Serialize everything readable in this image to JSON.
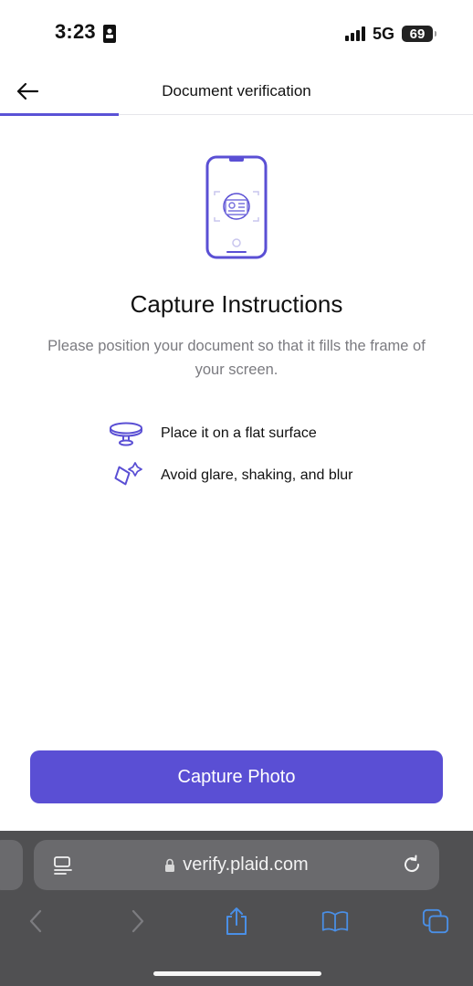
{
  "status_bar": {
    "time": "3:23",
    "network": "5G",
    "battery": "69"
  },
  "header": {
    "back_icon": "arrow-left-icon",
    "title": "Document verification",
    "progress_fraction": 0.25
  },
  "content": {
    "illustration_icon": "phone-document-scan-icon",
    "title": "Capture Instructions",
    "subtitle": "Please position your document so that it fills the frame of your screen.",
    "tips": [
      {
        "icon": "flat-surface-icon",
        "text": "Place it on a flat surface"
      },
      {
        "icon": "sparkle-glare-icon",
        "text": "Avoid glare, shaking, and blur"
      }
    ]
  },
  "primary_button": {
    "label": "Capture Photo"
  },
  "browser": {
    "url": "verify.plaid.com",
    "toolbar": [
      "back-icon",
      "forward-icon",
      "share-icon",
      "bookmarks-icon",
      "tabs-icon"
    ]
  },
  "colors": {
    "accent": "#5a4fd4",
    "text_primary": "#111111",
    "text_secondary": "#7b7b80",
    "browser_bg": "#505052",
    "browser_blue": "#4a8fe6"
  }
}
